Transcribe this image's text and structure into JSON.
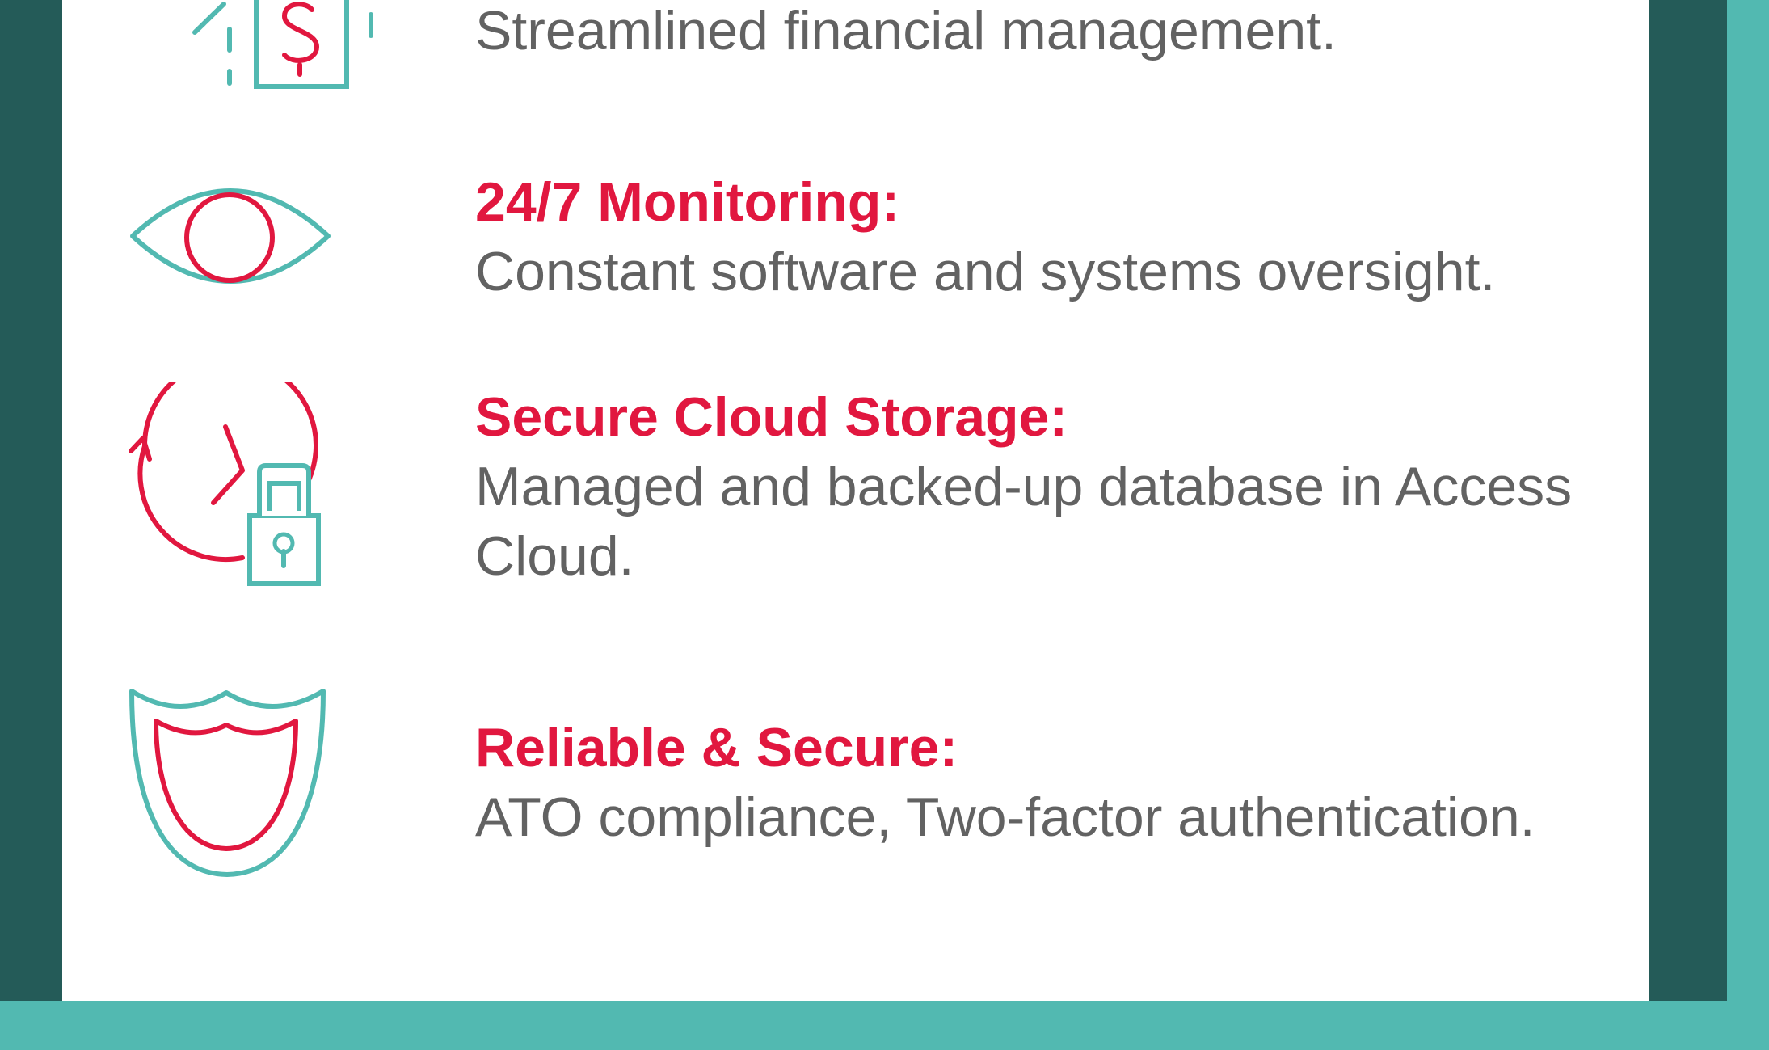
{
  "colors": {
    "teal_border": "#52b9b1",
    "dark_teal_frame": "#245b58",
    "panel_background": "#ffffff",
    "accent_red": "#e1173f",
    "icon_teal": "#52b9b1",
    "body_text_gray": "#626262"
  },
  "features": [
    {
      "icon": "money-house-icon",
      "title": "",
      "description": "Streamlined financial management."
    },
    {
      "icon": "eye-icon",
      "title": "24/7 Monitoring:",
      "description": "Constant software and systems oversight."
    },
    {
      "icon": "clock-lock-icon",
      "title": "Secure Cloud Storage:",
      "description": "Managed and backed-up database in Access Cloud."
    },
    {
      "icon": "shield-icon",
      "title": "Reliable & Secure:",
      "description": "ATO compliance, Two-factor authentication."
    }
  ]
}
